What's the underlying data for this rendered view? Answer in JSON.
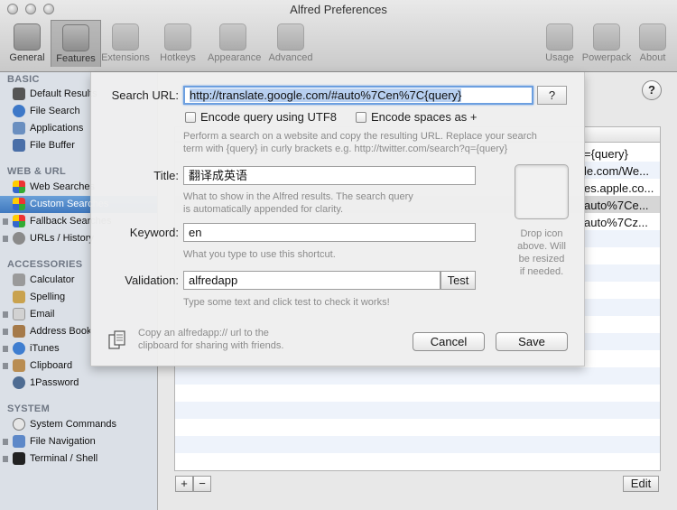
{
  "window": {
    "title": "Alfred Preferences"
  },
  "toolbar": [
    {
      "label": "General",
      "icon": "general-icon"
    },
    {
      "label": "Features",
      "icon": "features-icon"
    },
    {
      "label": "Extensions",
      "icon": "extensions-icon"
    },
    {
      "label": "Hotkeys",
      "icon": "hotkeys-icon"
    },
    {
      "label": "Appearance",
      "icon": "appearance-icon"
    },
    {
      "label": "Advanced",
      "icon": "advanced-icon"
    },
    {
      "label": "Usage",
      "icon": "usage-icon"
    },
    {
      "label": "Powerpack",
      "icon": "powerpack-icon"
    },
    {
      "label": "About",
      "icon": "about-icon"
    }
  ],
  "sidebar": {
    "sections": [
      {
        "title": "BASIC",
        "items": [
          {
            "label": "Default Results",
            "icon": "hat-icon"
          },
          {
            "label": "File Search",
            "icon": "magnifier-icon"
          },
          {
            "label": "Applications",
            "icon": "applications-icon"
          },
          {
            "label": "File Buffer",
            "icon": "file-buffer-icon"
          }
        ]
      },
      {
        "title": "WEB & URL",
        "items": [
          {
            "label": "Web Searches",
            "icon": "web-searches-icon"
          },
          {
            "label": "Custom Searches",
            "icon": "custom-searches-icon",
            "selected": true
          },
          {
            "label": "Fallback Searches",
            "icon": "fallback-icon"
          },
          {
            "label": "URLs / History",
            "icon": "link-icon"
          }
        ]
      },
      {
        "title": "ACCESSORIES",
        "items": [
          {
            "label": "Calculator",
            "icon": "calculator-icon"
          },
          {
            "label": "Spelling",
            "icon": "spelling-icon"
          },
          {
            "label": "Email",
            "icon": "email-icon"
          },
          {
            "label": "Address Book",
            "icon": "address-book-icon"
          },
          {
            "label": "iTunes",
            "icon": "itunes-icon"
          },
          {
            "label": "Clipboard",
            "icon": "clipboard-icon"
          },
          {
            "label": "1Password",
            "icon": "1password-icon"
          }
        ]
      },
      {
        "title": "SYSTEM",
        "items": [
          {
            "label": "System Commands",
            "icon": "power-icon"
          },
          {
            "label": "File Navigation",
            "icon": "finder-icon"
          },
          {
            "label": "Terminal / Shell",
            "icon": "terminal-icon"
          }
        ]
      }
    ]
  },
  "table": {
    "rows": [
      {
        "url_tail": "={query}"
      },
      {
        "url_tail": "le.com/We..."
      },
      {
        "url_tail": "es.apple.co..."
      },
      {
        "url_tail": "auto%7Ce...",
        "selected": true
      },
      {
        "url_tail": "auto%7Cz..."
      }
    ],
    "add_label": "+",
    "remove_label": "−",
    "edit_label": "Edit"
  },
  "help_button": "?",
  "sheet": {
    "search_url": {
      "label": "Search URL:",
      "value": "http://translate.google.com/#auto%7Cen%7C{query}",
      "help_button": "?"
    },
    "encode_utf8": {
      "label": "Encode query using UTF8",
      "checked": false
    },
    "encode_spaces": {
      "label": "Encode spaces as +",
      "checked": false
    },
    "search_help": "Perform a search on a website and copy the resulting URL. Replace your search\nterm with {query} in curly brackets e.g. http://twitter.com/search?q={query}",
    "title": {
      "label": "Title:",
      "value": "翻译成英语",
      "help": "What to show in the Alfred results. The search query\nis automatically appended for clarity."
    },
    "keyword": {
      "label": "Keyword:",
      "value": "en",
      "help": "What you type to use this shortcut."
    },
    "validation": {
      "label": "Validation:",
      "value": "alfredapp",
      "test_label": "Test",
      "help": "Type some text and click test to check it works!"
    },
    "drop_icon": "Drop icon\nabove. Will\nbe resized\nif needed.",
    "copy_text": "Copy an alfredapp:// url to the\nclipboard for sharing with friends.",
    "cancel_label": "Cancel",
    "save_label": "Save"
  },
  "colors": {
    "selection": "#3f78bf",
    "focus": "#6c9fe0"
  }
}
